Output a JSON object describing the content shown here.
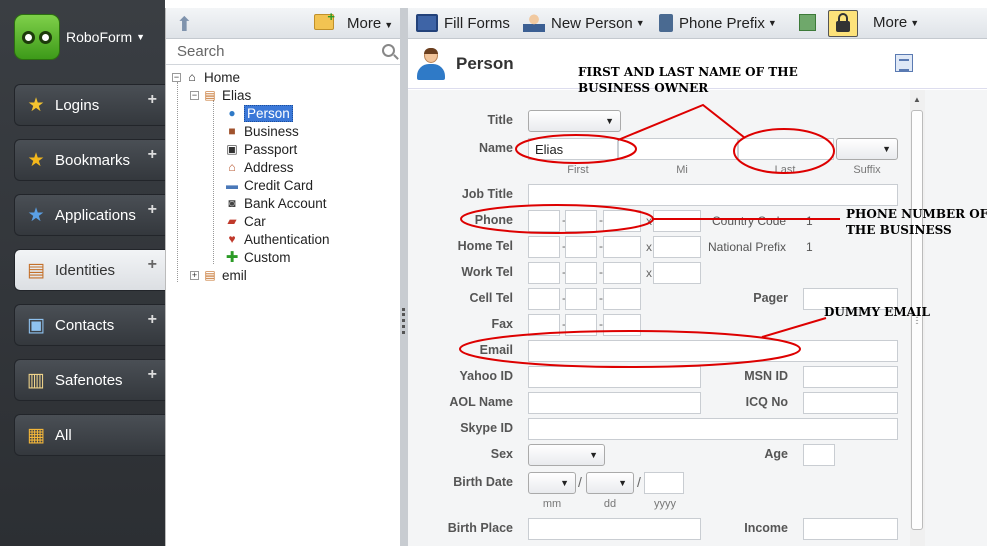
{
  "brand": {
    "name": "RoboForm"
  },
  "sidebar": {
    "items": [
      {
        "label": "Logins",
        "icon": "logins-icon"
      },
      {
        "label": "Bookmarks",
        "icon": "bookmarks-icon"
      },
      {
        "label": "Applications",
        "icon": "applications-icon"
      },
      {
        "label": "Identities",
        "icon": "identities-icon",
        "active": true
      },
      {
        "label": "Contacts",
        "icon": "contacts-icon"
      },
      {
        "label": "Safenotes",
        "icon": "safenotes-icon"
      },
      {
        "label": "All",
        "icon": "all-icon"
      }
    ]
  },
  "tree_panel": {
    "more_label": "More",
    "search_placeholder": "Search",
    "nodes": {
      "home": "Home",
      "elias": "Elias",
      "person": "Person",
      "business": "Business",
      "passport": "Passport",
      "address": "Address",
      "credit_card": "Credit Card",
      "bank_account": "Bank Account",
      "car": "Car",
      "authentication": "Authentication",
      "custom": "Custom",
      "emil": "emil"
    }
  },
  "toolbar": {
    "fill_forms": "Fill Forms",
    "new_person": "New Person",
    "phone_prefix": "Phone Prefix",
    "more": "More"
  },
  "form": {
    "header_title": "Person",
    "labels": {
      "title": "Title",
      "name": "Name",
      "job_title": "Job Title",
      "phone": "Phone",
      "home_tel": "Home Tel",
      "work_tel": "Work Tel",
      "cell_tel": "Cell Tel",
      "pager": "Pager",
      "fax": "Fax",
      "email": "Email",
      "yahoo_id": "Yahoo ID",
      "msn_id": "MSN ID",
      "aol_name": "AOL Name",
      "icq_no": "ICQ No",
      "skype_id": "Skype ID",
      "sex": "Sex",
      "age": "Age",
      "birth_date": "Birth Date",
      "birth_place": "Birth Place",
      "income": "Income"
    },
    "name_sub": {
      "first": "First",
      "mi": "Mi",
      "last": "Last",
      "suffix": "Suffix"
    },
    "name_first_value": "Elias",
    "phone_info": {
      "country_code_label": "Country Code",
      "country_code_value": "1",
      "national_prefix_label": "National Prefix",
      "national_prefix_value": "1"
    },
    "phone_ext_marker": "x",
    "date_sub": {
      "mm": "mm",
      "dd": "dd",
      "yyyy": "yyyy"
    },
    "date_sep": "/"
  },
  "annotations": {
    "name": "FIRST AND LAST NAME OF THE BUSINESS OWNER",
    "phone": "PHONE NUMBER OF THE BUSINESS",
    "email": "DUMMY EMAIL",
    "color": "#dd0000"
  }
}
